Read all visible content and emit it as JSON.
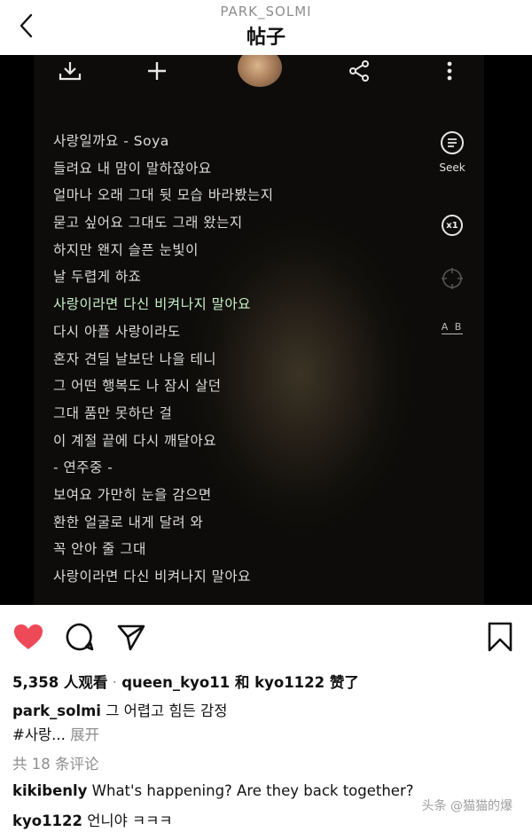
{
  "header": {
    "username": "PARK_SOLMI",
    "title": "帖子",
    "back_icon": "chevron-left-icon"
  },
  "media": {
    "top_icons": [
      "download-icon",
      "plus-icon",
      "share-icon",
      "more-vertical-icon"
    ],
    "lyrics": [
      "사랑일까요 - Soya",
      "들려요 내 맘이 말하잖아요",
      "얼마나 오래 그대 뒷 모습 바라봤는지",
      "묻고 싶어요 그대도 그래 왔는지",
      "하지만 왠지 슬픈 눈빛이",
      "날 두렵게 하죠",
      "사랑이라면 다신 비켜나지 말아요",
      "다시 아플 사랑이라도",
      "혼자 견딜 날보단 나을 테니",
      "그 어떤 행복도 나 잠시 살던",
      "그대 품만 못하단 걸",
      "이 계절 끝에 다시 깨달아요",
      "- 연주중 -",
      "보여요 가만히 눈을 감으면",
      "환한 얼굴로 내게 달려 와",
      "꼭 안아 줄 그대",
      "사랑이라면 다신 비켜나지 말아요"
    ],
    "highlight_color": "#c6efc7",
    "side": {
      "seek_label": "Seek",
      "speed_label": "x1",
      "ab_label": "A B"
    }
  },
  "actions": {
    "like_color": "#ed4956",
    "icons": [
      "heart-icon",
      "comment-icon",
      "send-icon",
      "bookmark-icon"
    ]
  },
  "stats": {
    "views": "5,358 人观看",
    "dot": "·",
    "likers": "queen_kyo11 和 kyo1122 赞了"
  },
  "caption": {
    "user": "park_solmi",
    "text": "그 어렵고 힘든 감정",
    "tag": "#사랑...",
    "more": "展开"
  },
  "comments_count": "共 18 条评论",
  "comments": [
    {
      "user": "kikibenly",
      "text": "What's happening?  Are they back together?"
    },
    {
      "user": "kyo1122",
      "text": "언니야 ㅋㅋㅋ"
    }
  ],
  "watermark": "头条 @猫猫的爆"
}
